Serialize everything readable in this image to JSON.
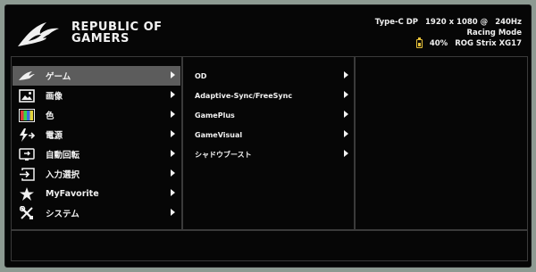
{
  "header": {
    "brand_line1": "REPUBLIC OF",
    "brand_line2": "GAMERS",
    "input_source": "Type-C DP",
    "resolution": "1920 x 1080 @",
    "refresh_rate": "240Hz",
    "mode": "Racing Mode",
    "battery_level": "40%",
    "model": "ROG Strix XG17",
    "battery_color": "#e8c23a"
  },
  "main_menu": {
    "items": [
      {
        "label": "ゲーム",
        "icon": "rog-eye-icon",
        "selected": true
      },
      {
        "label": "画像",
        "icon": "image-icon",
        "selected": false
      },
      {
        "label": "色",
        "icon": "color-bars-icon",
        "selected": false
      },
      {
        "label": "電源",
        "icon": "power-bolt-icon",
        "selected": false
      },
      {
        "label": "自動回転",
        "icon": "auto-rotate-icon",
        "selected": false
      },
      {
        "label": "入力選択",
        "icon": "input-select-icon",
        "selected": false
      },
      {
        "label": "MyFavorite",
        "icon": "star-icon",
        "selected": false
      },
      {
        "label": "システム",
        "icon": "wrench-screwdriver-icon",
        "selected": false
      }
    ]
  },
  "sub_menu": {
    "items": [
      {
        "label": "OD"
      },
      {
        "label": "Adaptive-Sync/FreeSync"
      },
      {
        "label": "GamePlus"
      },
      {
        "label": "GameVisual"
      },
      {
        "label": "シャドウブースト"
      }
    ]
  },
  "colors": {
    "selected_bg": "#5c5c5c",
    "background": "#060606",
    "divider": "#3a3a3a"
  }
}
